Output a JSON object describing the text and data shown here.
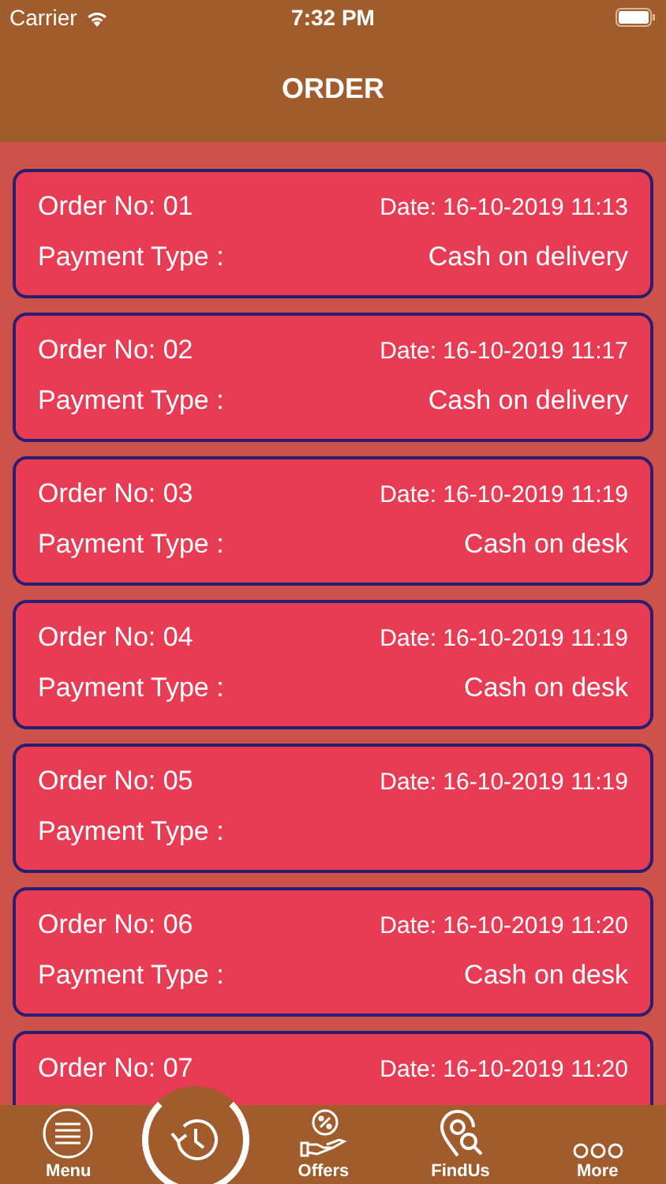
{
  "status_bar": {
    "carrier": "Carrier",
    "time": "7:32 PM"
  },
  "header": {
    "title": "ORDER"
  },
  "orders": [
    {
      "order_no": "Order No: 01",
      "date": "Date: 16-10-2019 11:13",
      "payment_label": "Payment Type :",
      "payment_value": "Cash on delivery"
    },
    {
      "order_no": "Order No: 02",
      "date": "Date: 16-10-2019 11:17",
      "payment_label": "Payment Type :",
      "payment_value": "Cash on delivery"
    },
    {
      "order_no": "Order No: 03",
      "date": "Date: 16-10-2019 11:19",
      "payment_label": "Payment Type :",
      "payment_value": "Cash on desk"
    },
    {
      "order_no": "Order No: 04",
      "date": "Date: 16-10-2019 11:19",
      "payment_label": "Payment Type :",
      "payment_value": "Cash on desk"
    },
    {
      "order_no": "Order No: 05",
      "date": "Date: 16-10-2019 11:19",
      "payment_label": "Payment Type :"
    },
    {
      "order_no": "Order No: 06",
      "date": "Date: 16-10-2019 11:20",
      "payment_label": "Payment Type :",
      "payment_value": "Cash on desk"
    },
    {
      "order_no": "Order No: 07",
      "date": "Date: 16-10-2019 11:20"
    }
  ],
  "tab_bar": [
    {
      "kind": "menu",
      "label": "Menu"
    },
    {
      "kind": "history"
    },
    {
      "kind": "offers",
      "label": "Offers"
    },
    {
      "kind": "findus",
      "label": "FindUs"
    },
    {
      "kind": "more",
      "label": "More"
    }
  ]
}
